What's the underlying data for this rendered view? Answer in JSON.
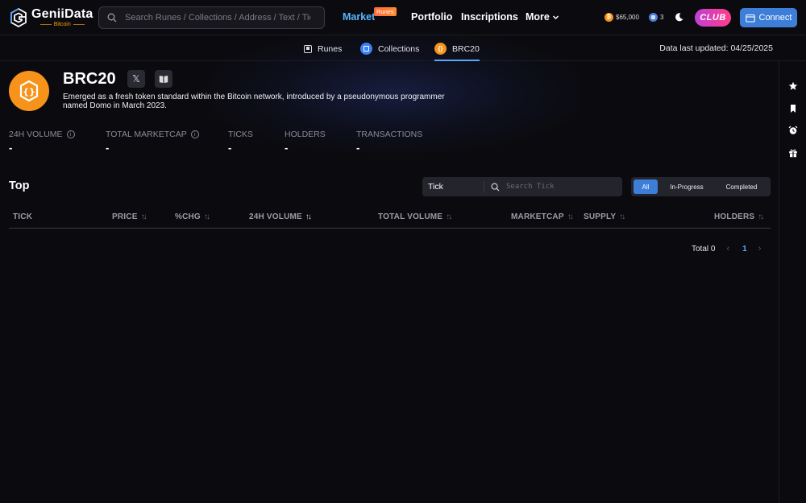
{
  "header": {
    "logo_name": "GeniiData",
    "logo_sub": "Bitcoin",
    "search_placeholder": "Search Runes / Collections / Address / Text / Tick",
    "nav": {
      "market": "Market",
      "market_badge": "Runes",
      "portfolio": "Portfolio",
      "inscriptions": "Inscriptions",
      "more": "More"
    },
    "btc_price": "$65,000",
    "gas": "3",
    "club_label": "CLUB",
    "connect_label": "Connect"
  },
  "subnav": {
    "tabs": [
      {
        "label": "Runes"
      },
      {
        "label": "Collections"
      },
      {
        "label": "BRC20",
        "active": true
      }
    ],
    "data_updated": "Data last updated: 04/25/2025"
  },
  "token": {
    "title": "BRC20",
    "description": "Emerged as a fresh token standard within the Bitcoin network, introduced by a pseudonymous programmer named Domo in March 2023."
  },
  "stats": [
    {
      "label": "24H VOLUME",
      "value": "-"
    },
    {
      "label": "TOTAL MARKETCAP",
      "value": "-"
    },
    {
      "label": "TICKS",
      "value": "-"
    },
    {
      "label": "HOLDERS",
      "value": "-"
    },
    {
      "label": "TRANSACTIONS",
      "value": "-"
    }
  ],
  "top": {
    "title": "Top",
    "filter_select": "Tick",
    "filter_placeholder": "Search Tick",
    "segments": [
      "All",
      "In-Progress",
      "Completed"
    ],
    "selected_segment": "All"
  },
  "table": {
    "columns": [
      "TICK",
      "PRICE",
      "%CHG",
      "24H VOLUME",
      "TOTAL VOLUME",
      "MARKETCAP",
      "SUPPLY",
      "HOLDERS"
    ],
    "rows": []
  },
  "pagination": {
    "total": "Total 0",
    "current_page": "1"
  },
  "colors": {
    "background": "#0b0b0f",
    "accent_blue": "#3d7fd8",
    "brand_orange": "#f7931a",
    "club_gradient_start": "#c03fd6",
    "club_gradient_end": "#ff3e8a"
  }
}
